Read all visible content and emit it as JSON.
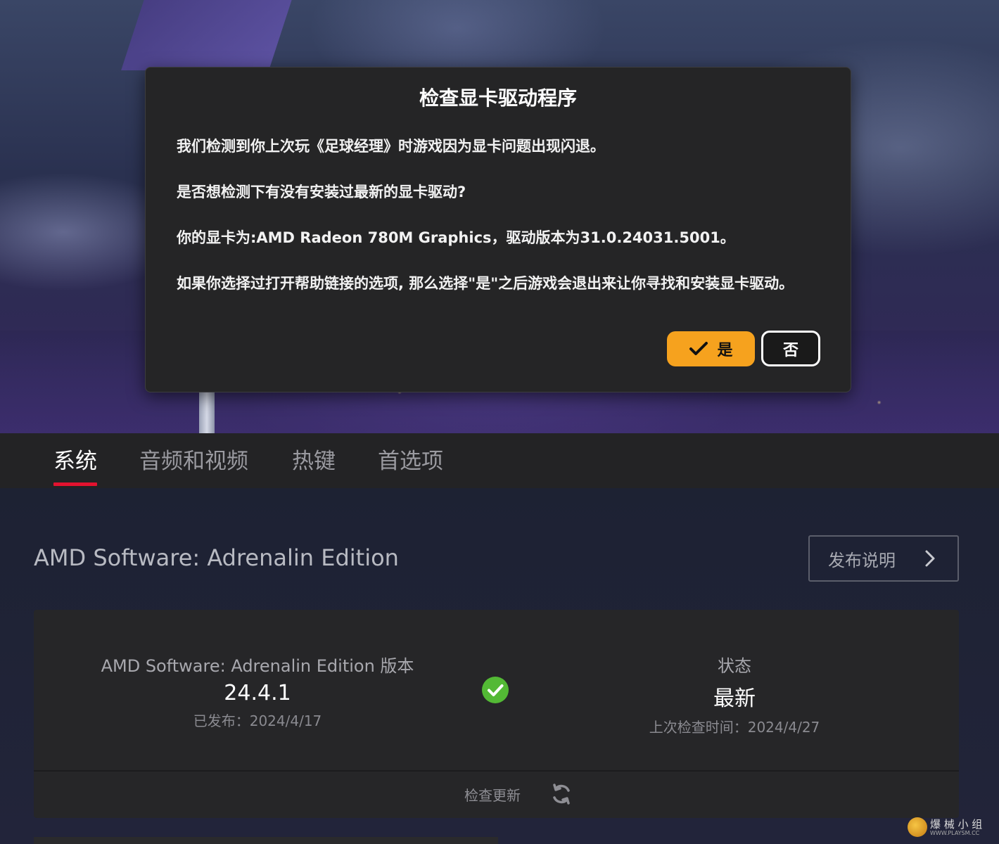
{
  "dialog": {
    "title": "检查显卡驱动程序",
    "line1": "我们检测到你上次玩《足球经理》时游戏因为显卡问题出现闪退。",
    "line2": "是否想检测下有没有安装过最新的显卡驱动?",
    "line3": "你的显卡为:AMD Radeon 780M Graphics，驱动版本为31.0.24031.5001。",
    "line4": "如果你选择过打开帮助链接的选项, 那么选择\"是\"之后游戏会退出来让你寻找和安装显卡驱动。",
    "yes_label": "是",
    "no_label": "否"
  },
  "tabs": [
    {
      "label": "系统",
      "active": true
    },
    {
      "label": "音频和视频",
      "active": false
    },
    {
      "label": "热键",
      "active": false
    },
    {
      "label": "首选项",
      "active": false
    }
  ],
  "software": {
    "title": "AMD Software: Adrenalin Edition",
    "release_notes_label": "发布说明",
    "version_label": "AMD Software: Adrenalin Edition 版本",
    "version": "24.4.1",
    "released": "已发布：2024/4/17",
    "status_label": "状态",
    "status": "最新",
    "last_checked": "上次检查时间：2024/4/27",
    "check_update_label": "检查更新"
  },
  "watermark": {
    "text": "爆 械 小 组",
    "url": "WWW.PLAYSM.CC"
  },
  "colors": {
    "accent_orange": "#f6a21e",
    "tab_underline": "#e3122f",
    "status_green": "#53b935"
  }
}
